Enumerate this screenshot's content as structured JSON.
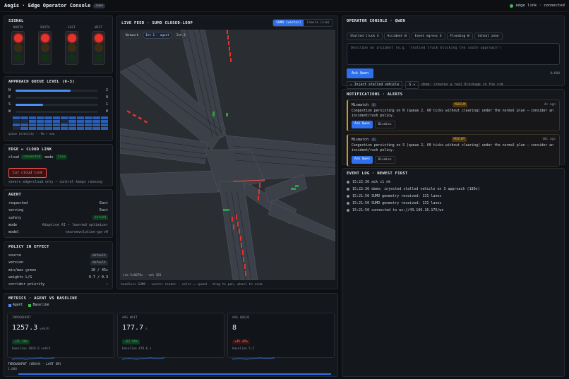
{
  "app": {
    "title": "Aegis · Edge Operator Console",
    "badge": "sumo",
    "connection": "edge link · connected"
  },
  "signal": {
    "title": "SIGNAL",
    "approaches": [
      {
        "label": "NORTH",
        "state": "red"
      },
      {
        "label": "SOUTH",
        "state": "red"
      },
      {
        "label": "EAST",
        "state": "red"
      },
      {
        "label": "WEST",
        "state": "red"
      }
    ]
  },
  "queue": {
    "title": "APPROACH QUEUE LEVEL (0-3)",
    "rows": [
      {
        "label": "N",
        "value": "2",
        "level": 0.67
      },
      {
        "label": "E",
        "value": "0",
        "level": 0
      },
      {
        "label": "S",
        "value": "1",
        "level": 0.33
      },
      {
        "label": "W",
        "value": "0",
        "level": 0
      }
    ],
    "heat_labels": [
      "N",
      "E",
      "S",
      "W"
    ],
    "footer": "queue intensity · -9m → now"
  },
  "edge": {
    "title": "EDGE ↔ CLOUD LINK",
    "cloud_label": "cloud",
    "cloud_status": "connected",
    "mode_label": "mode",
    "mode_value": "live",
    "cut_button": "Cut cloud link",
    "note": "severs edge↔cloud only — control keeps running"
  },
  "agent": {
    "title": "AGENT",
    "rows": [
      {
        "k": "requested",
        "v": "East"
      },
      {
        "k": "serving",
        "v": "East"
      },
      {
        "k": "safety",
        "v": "served"
      },
      {
        "k": "mode",
        "v": "Adaptive AI — learned optimizer"
      },
      {
        "k": "model",
        "v": "neuroevolution-ga-v0"
      }
    ]
  },
  "policy": {
    "title": "POLICY IN EFFECT",
    "rows": [
      {
        "k": "source",
        "v": "default"
      },
      {
        "k": "version",
        "v": "default"
      },
      {
        "k": "min/max green",
        "v": "10 / 45s"
      },
      {
        "k": "weights L/G",
        "v": "0.7 / 0.3"
      },
      {
        "k": "corridor priority",
        "v": "—"
      }
    ]
  },
  "feed": {
    "title": "LIVE FEED · SUMO CLOSED-LOOP",
    "toggle": [
      "SUMO (vector)",
      "Camera (sim)"
    ],
    "chips": [
      "Network",
      "Int 1 · agent",
      "Int 2"
    ],
    "overlay": "sim 5v0070s · veh 183",
    "caption": "headless SUMO · vector render · color = speed · drag to pan, wheel to zoom"
  },
  "operator": {
    "title": "OPERATOR CONSOLE · QWEN",
    "tags": [
      "Stalled truck S",
      "Accident N",
      "Event egress E",
      "Flooding W",
      "School zone"
    ],
    "placeholder": "Describe an incident (e.g. 'stalled truck blocking the south approach')",
    "ask_button": "Ask Qwen",
    "counter": "0/600",
    "inject_button": "⚠ Inject stalled vehicle",
    "inject_select": "S",
    "inject_note": "demo: creates a real blockage in the sim"
  },
  "notifications": {
    "title": "NOTIFICATIONS · ALERTS",
    "items": [
      {
        "kind": "Mismatch",
        "severity": "MEDIUM",
        "time": "4s ago",
        "text": "Congestion persisting on N (queue 2, 60 ticks without clearing) under the normal plan — consider an incident/rush policy.",
        "ask": "Ask Qwen",
        "dismiss": "Dismiss"
      },
      {
        "kind": "Mismatch",
        "severity": "MEDIUM",
        "time": "10s ago",
        "text": "Congestion persisting on S (queue 2, 60 ticks without clearing) under the normal plan — consider an incident/rush policy.",
        "ask": "Ask Qwen",
        "dismiss": "Dismiss"
      }
    ]
  },
  "eventlog": {
    "title": "EVENT LOG · NEWEST FIRST",
    "items": [
      "15:22:36 ack c1 ok",
      "15:22:36 demo: injected stalled vehicle on S approach (180s)",
      "15:21:50 SUMO geometry received: 131 lanes",
      "15:21:50 SUMO geometry received: 131 lanes",
      "15:21:50 connected to ws://43.106.16.175/ws"
    ]
  },
  "metrics": {
    "title": "METRICS · AGENT VS BASELINE",
    "legend": [
      "Agent",
      "Baseline"
    ],
    "cards": [
      {
        "label": "THROUGHPUT",
        "value": "1257.3",
        "unit": "veh/h",
        "delta": "+31.38%",
        "delta_kind": "g",
        "baseline": "baseline 1019.6 veh/h"
      },
      {
        "label": "AVG WAIT",
        "value": "177.7",
        "unit": "s",
        "delta": "-62.56%",
        "delta_kind": "g",
        "baseline": "baseline 478.6 s"
      },
      {
        "label": "AVG QUEUE",
        "value": "8",
        "unit": "",
        "delta": "+45.45%",
        "delta_kind": "r",
        "baseline": "baseline 5.5"
      }
    ],
    "chart_label": "THROUGHPUT (VEH/H · LAST 5M)",
    "chart_tick": "1,000"
  },
  "colors": {
    "accent": "#2f6feb",
    "red": "#f85149",
    "green": "#3fb950",
    "amber": "#d29922"
  }
}
